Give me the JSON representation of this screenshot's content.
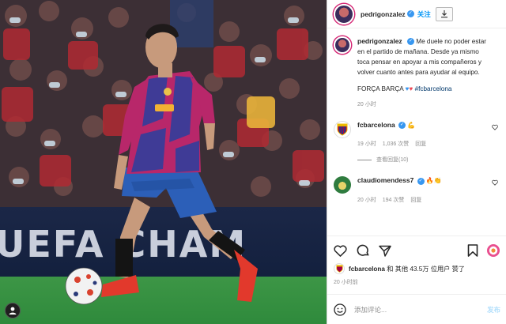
{
  "photo": {
    "banner_text": "UEFA CHAM"
  },
  "header": {
    "username": "pedrigonzalez",
    "follow_label": "关注"
  },
  "caption": {
    "username": "pedrigonzalez",
    "text": "Me duele no poder estar en el partido de mañana. Desde ya mismo toca pensar en apoyar a mis compañeros y volver cuanto antes para ayudar al equipo.",
    "signoff": "FORÇA BARÇA",
    "hashtag": "#fcbarcelona",
    "time": "20 小时"
  },
  "comments": [
    {
      "username": "fcbarcelona",
      "text": "💪",
      "time": "19 小时",
      "likes": "1,036 次赞",
      "reply": "回复",
      "view_replies": "查看回复(10)"
    },
    {
      "username": "claudiomendess7",
      "text": "🔥👏",
      "time": "20 小时",
      "likes": "194 次赞",
      "reply": "回复"
    }
  ],
  "likes_line": {
    "first_user": "fcbarcelona",
    "text": " 和 其他 43.5万 位用户 赞了"
  },
  "post_time": "20 小时前",
  "comment_box": {
    "placeholder": "添加评论...",
    "post_label": "发布"
  },
  "colors": {
    "accent": "#0095f6",
    "verified": "#3897f0",
    "muted": "#8e8e8e"
  }
}
